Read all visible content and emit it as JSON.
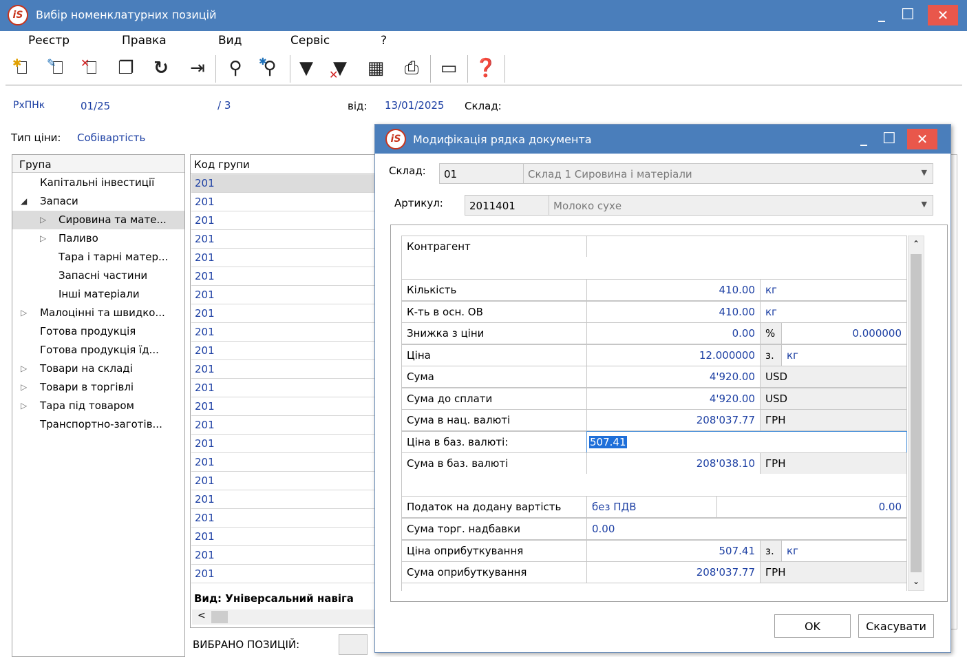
{
  "window": {
    "title": "Вибір номенклатурних позицій",
    "min": "_",
    "max": "☐",
    "close": "✕"
  },
  "menu": [
    "Реєстр",
    "Правка",
    "Вид",
    "Сервіс",
    "?"
  ],
  "header": {
    "doc_type": "РхПНк",
    "doc_number": "01/25",
    "doc_suffix": "/ 3",
    "date_label": "від:",
    "date": "13/01/2025",
    "warehouse_label": "Склад:",
    "price_type_label": "Тип ціни:",
    "price_type": "Собівартість"
  },
  "tree": {
    "header": "Група",
    "items": [
      {
        "label": "Капітальні інвестиції"
      },
      {
        "label": "Запаси"
      },
      {
        "label": "Сировина та мате..."
      },
      {
        "label": "Паливо"
      },
      {
        "label": "Тара і тарні матер..."
      },
      {
        "label": "Запасні частини"
      },
      {
        "label": "Інші матеріали"
      },
      {
        "label": "Малоцінні та швидко..."
      },
      {
        "label": "Готова продукція"
      },
      {
        "label": "Готова продукція їд..."
      },
      {
        "label": "Товари на складі"
      },
      {
        "label": "Товари в  торгівлі"
      },
      {
        "label": "Тара під товаром"
      },
      {
        "label": "Транспортно-заготів..."
      }
    ]
  },
  "codes": {
    "header": "Код групи",
    "values": [
      "201",
      "201",
      "201",
      "201",
      "201",
      "201",
      "201",
      "201",
      "201",
      "201",
      "201",
      "201",
      "201",
      "201",
      "201",
      "201",
      "201",
      "201",
      "201",
      "201",
      "201",
      "201"
    ],
    "footer": "Вид: Універсальний навіга",
    "scroll_left": "<"
  },
  "selected_label": "ВИБРАНО ПОЗИЦІЙ:",
  "dialog": {
    "title": "Модифікація рядка документа",
    "min": "_",
    "max": "☐",
    "close": "✕",
    "warehouse_label": "Склад:",
    "warehouse_code": "01",
    "warehouse_name": "Склад 1 Сировина і матеріали",
    "article_label": "Артикул:",
    "article_code": "2011401",
    "article_name": "Молоко сухе",
    "rows": {
      "counterparty": "Контрагент",
      "qty_label": "Кількість",
      "qty": "410.00",
      "qty_unit": "кг",
      "qty_base_label": "К-ть в осн. ОВ",
      "qty_base": "410.00",
      "qty_base_unit": "кг",
      "discount_label": "Знижка з ціни",
      "discount": "0.00",
      "discount_unit": "%",
      "discount_pct": "0.000000",
      "price_label": "Ціна",
      "price": "12.000000",
      "price_z": "з.",
      "price_unit": "кг",
      "sum_label": "Сума",
      "sum": "4'920.00",
      "sum_cur": "USD",
      "sum_pay_label": "Сума до сплати",
      "sum_pay": "4'920.00",
      "sum_pay_cur": "USD",
      "sum_nat_label": "Сума в нац. валюті",
      "sum_nat": "208'037.77",
      "sum_nat_cur": "ГРН",
      "price_base_label": "Ціна в баз. валюті:",
      "price_base": "507.41",
      "sum_base_label": "Сума в баз. валюті",
      "sum_base": "208'038.10",
      "sum_base_cur": "ГРН",
      "vat_label": "Податок на додану вартість",
      "vat_type": "без ПДВ",
      "vat_value": "0.00",
      "markup_label": "Сума торг. надбавки",
      "markup": "0.00",
      "cost_price_label": "Ціна оприбуткування",
      "cost_price": "507.41",
      "cost_price_z": "з.",
      "cost_price_unit": "кг",
      "cost_sum_label": "Сума оприбуткування",
      "cost_sum": "208'037.77",
      "cost_sum_cur": "ГРН"
    },
    "ok": "OK",
    "cancel": "Скасувати"
  }
}
